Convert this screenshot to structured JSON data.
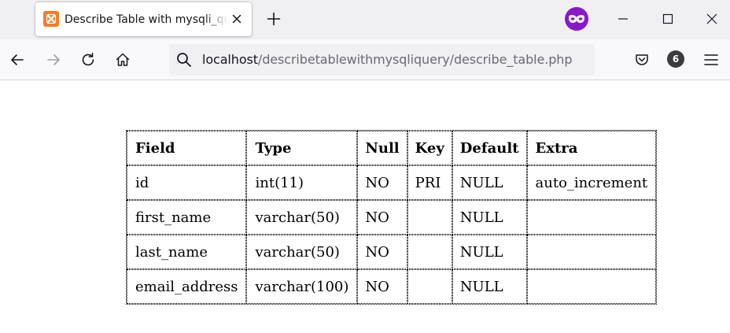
{
  "browser": {
    "tab": {
      "title": "Describe Table with mysqli_query",
      "favicon": "xampp-icon"
    },
    "new_tab_icon": "plus-icon",
    "extension_icon": "mask-icon",
    "window_controls": [
      "minimize-icon",
      "maximize-icon",
      "close-icon"
    ],
    "nav": {
      "back_icon": "back-arrow-icon",
      "forward_icon": "forward-arrow-icon",
      "reload_icon": "reload-icon",
      "home_icon": "home-icon"
    },
    "address": {
      "host": "localhost",
      "path": "/describetablewithmysqliquery/describe_table.php"
    },
    "toolbar_right": {
      "pocket_icon": "pocket-icon",
      "account_badge": "6",
      "menu_icon": "hamburger-menu-icon"
    }
  },
  "table": {
    "headers": [
      "Field",
      "Type",
      "Null",
      "Key",
      "Default",
      "Extra"
    ],
    "rows": [
      [
        "id",
        "int(11)",
        "NO",
        "PRI",
        "NULL",
        "auto_increment"
      ],
      [
        "first_name",
        "varchar(50)",
        "NO",
        "",
        "NULL",
        ""
      ],
      [
        "last_name",
        "varchar(50)",
        "NO",
        "",
        "NULL",
        ""
      ],
      [
        "email_address",
        "varchar(100)",
        "NO",
        "",
        "NULL",
        ""
      ]
    ]
  },
  "colors": {
    "tabstrip_bg": "#f0f0f4",
    "toolbar_bg": "#f9f9fb",
    "favicon_orange": "#fb7a24",
    "extension_purple": "#8a18c9"
  }
}
